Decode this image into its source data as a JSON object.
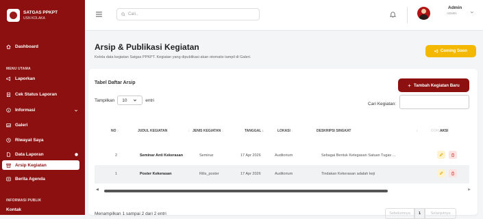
{
  "brand": {
    "title": "SATGAS PPKPT",
    "subtitle": "USN KOLAKA"
  },
  "sidebar": {
    "items": [
      {
        "label": "Dashboard"
      },
      {
        "label": "Laporkan"
      },
      {
        "label": "Cek Status Laporan"
      },
      {
        "label": "Informasi"
      },
      {
        "label": "Galeri"
      },
      {
        "label": "Riwayat Saya"
      },
      {
        "label": "Data Laporan"
      },
      {
        "label": "Arsip Kegiatan"
      },
      {
        "label": "Berita Agenda"
      },
      {
        "label": "Kontak"
      }
    ],
    "sections": {
      "main": "MENU UTAMA",
      "public": "INFORMASI PUBLIK"
    },
    "active": "Arsip Kegiatan"
  },
  "topbar": {
    "search_placeholder": "Cari..",
    "user_name": "Admin",
    "user_role": "ADMIN"
  },
  "page": {
    "title": "Arsip & Publikasi Kegiatan",
    "subtitle": "Kelola data kegiatan Satgas PPKPT. Kegiatan yang dipublikasi akan otomatis tampil di Galeri.",
    "coming_soon": "Coming Soon"
  },
  "table": {
    "title": "Tabel Daftar Arsip",
    "add_button": "Tambah Kegiatan Baru",
    "length_label_pre": "Tampilkan",
    "length_value": "10",
    "length_label_post": "entri",
    "filter_label": "Cari Kegiatan:",
    "columns": {
      "no": "NO",
      "judul": "JUDUL KEGIATAN",
      "jenis": "JENIS KEGIATAN",
      "tanggal": "TANGGAL",
      "lokasi": "LOKASI",
      "deskripsi": "DESKRIPSI SINGKAT",
      "dokumen": "DOKUMEN",
      "aksi": "AKSI"
    },
    "rows": [
      {
        "no": "2",
        "judul": "Seminar Anti Kekerasan",
        "jenis": "Seminar",
        "tanggal": "17 Apr 2026",
        "lokasi": "Auditorium",
        "deskripsi": "Sebagai Bentuk Ketegasan Satuan Tugas ..."
      },
      {
        "no": "1",
        "judul": "Poster Kekerasan",
        "jenis": "Rilis_poster",
        "tanggal": "17 Apr 2026",
        "lokasi": "Auditorium",
        "deskripsi": "Tindakan Kekerasan adalah keji"
      }
    ],
    "info": "Menampilkan 1 sampai 2 dari 2 entri",
    "pagination": {
      "prev": "Sebelumnya",
      "page": "1",
      "next": "Selanjutnya"
    }
  },
  "colors": {
    "primary": "#8c1010",
    "accent": "#f5b800"
  }
}
